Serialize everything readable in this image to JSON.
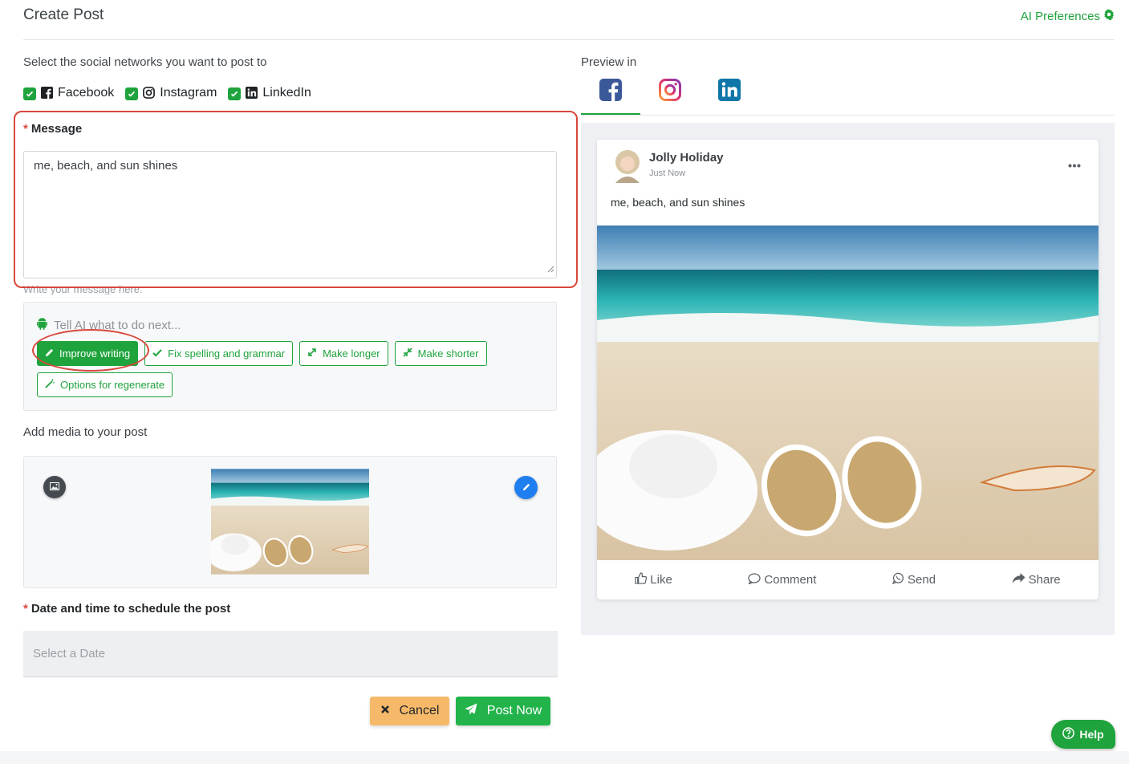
{
  "page": {
    "title": "Create Post",
    "ai_preferences": "AI Preferences"
  },
  "networks": {
    "label": "Select the social networks you want to post to",
    "items": [
      {
        "label": "Facebook",
        "checked": true,
        "icon": "facebook-icon"
      },
      {
        "label": "Instagram",
        "checked": true,
        "icon": "instagram-icon"
      },
      {
        "label": "LinkedIn",
        "checked": true,
        "icon": "linkedin-icon"
      }
    ]
  },
  "message": {
    "label": "Message",
    "value": "me, beach, and sun shines",
    "helper": "Write your message here."
  },
  "ai": {
    "prompt": "Tell AI what to do next...",
    "actions": [
      {
        "label": "Improve writing",
        "icon": "pencil-icon"
      },
      {
        "label": "Fix spelling and grammar",
        "icon": "check-icon"
      },
      {
        "label": "Make longer",
        "icon": "expand-icon"
      },
      {
        "label": "Make shorter",
        "icon": "compress-icon"
      },
      {
        "label": "Options for regenerate",
        "icon": "magic-wand-icon"
      }
    ]
  },
  "media": {
    "label": "Add media to your post"
  },
  "schedule": {
    "label": "Date and time to schedule the post",
    "placeholder": "Select a Date"
  },
  "buttons": {
    "cancel": "Cancel",
    "post_now": "Post Now",
    "help": "Help"
  },
  "preview": {
    "label": "Preview in",
    "tabs": [
      "facebook",
      "instagram",
      "linkedin"
    ],
    "active_tab": "facebook",
    "author": "Jolly Holiday",
    "time": "Just Now",
    "text": "me, beach, and sun shines",
    "actions": [
      "Like",
      "Comment",
      "Send",
      "Share"
    ]
  },
  "colors": {
    "accent": "#1fa33c",
    "highlight": "#d9473b",
    "cancel": "#f6b96a",
    "facebook": "#3b5998",
    "linkedin": "#0e76a8"
  }
}
